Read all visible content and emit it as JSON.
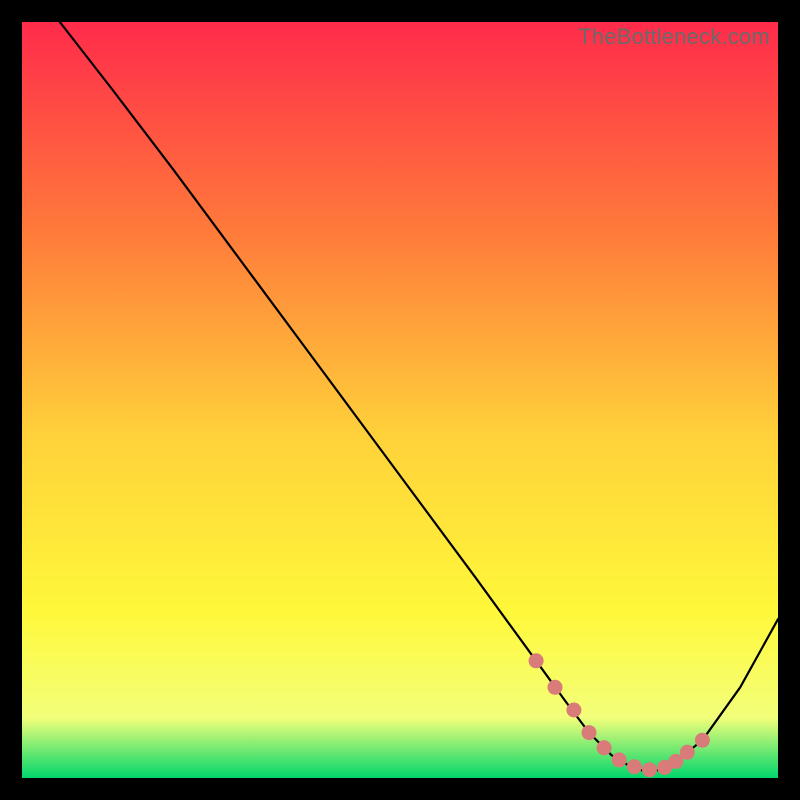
{
  "watermark": "TheBottleneck.com",
  "colors": {
    "gradient_top": "#ff2b4b",
    "gradient_mid_upper": "#ff7b3a",
    "gradient_mid": "#ffd23a",
    "gradient_mid_lower": "#fff83a",
    "gradient_low": "#f3ff7a",
    "gradient_bottom": "#00d66b",
    "curve": "#000000",
    "marker": "#d97b78"
  },
  "chart_data": {
    "type": "line",
    "title": "",
    "xlabel": "",
    "ylabel": "",
    "xlim": [
      0,
      100
    ],
    "ylim": [
      0,
      100
    ],
    "curve": {
      "x": [
        5,
        12,
        20,
        30,
        40,
        50,
        60,
        68,
        72,
        75,
        78,
        80,
        82,
        84,
        86,
        90,
        95,
        100
      ],
      "y": [
        100,
        91,
        80.5,
        67,
        53.5,
        40,
        26.5,
        15.5,
        10,
        6,
        3,
        1.8,
        1,
        1,
        1.8,
        5,
        12,
        21
      ]
    },
    "markers": {
      "x": [
        68,
        70.5,
        73,
        75,
        77,
        79,
        81,
        83,
        85,
        86.5,
        88,
        90
      ],
      "y": [
        15.5,
        12,
        9,
        6,
        4,
        2.4,
        1.5,
        1.1,
        1.4,
        2.2,
        3.4,
        5
      ]
    }
  }
}
